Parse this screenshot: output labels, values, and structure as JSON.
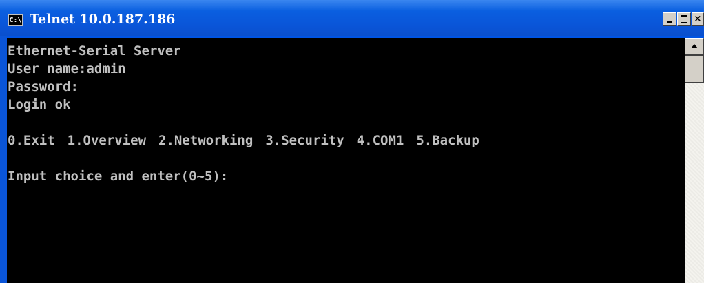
{
  "window": {
    "title": "Telnet 10.0.187.186",
    "icon": "console-icon",
    "icon_text": "C:\\",
    "buttons": {
      "minimize": "minimize-icon",
      "maximize": "maximize-icon",
      "close_label": "×"
    }
  },
  "terminal": {
    "lines": [
      "Ethernet-Serial Server",
      "User name:admin",
      "Password:",
      "Login ok",
      ""
    ],
    "menu": [
      "0.Exit",
      "1.Overview",
      "2.Networking",
      "3.Security",
      "4.COM1",
      "5.Backup"
    ],
    "blank_after_menu": "",
    "prompt": "Input choice and enter(0~5):"
  },
  "colors": {
    "titlebar": "#0a55d8",
    "terminal_bg": "#000000",
    "terminal_fg": "#c0c0c0"
  }
}
